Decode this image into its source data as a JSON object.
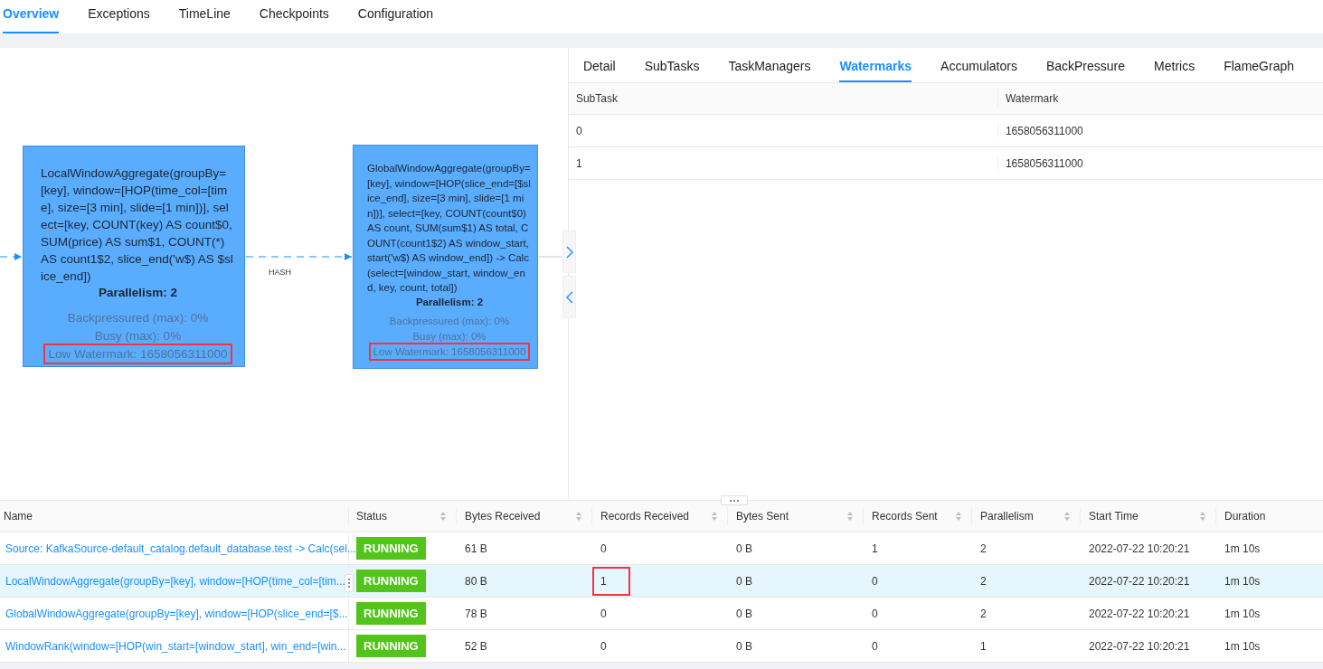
{
  "top_tabs": [
    {
      "label": "Overview",
      "selected": true
    },
    {
      "label": "Exceptions",
      "selected": false
    },
    {
      "label": "TimeLine",
      "selected": false
    },
    {
      "label": "Checkpoints",
      "selected": false
    },
    {
      "label": "Configuration",
      "selected": false
    }
  ],
  "graph": {
    "nodes": [
      {
        "text": "LocalWindowAggregate(groupBy=[key], window=[HOP(time_col=[time], size=[3 min], slide=[1 min])], select=[key, COUNT(key) AS count$0, SUM(price) AS sum$1, COUNT(*) AS count1$2, slice_end('w$) AS $slice_end])",
        "parallelism": "Parallelism: 2",
        "metrics": [
          {
            "text": "Backpressured (max): 0%",
            "highlighted": false
          },
          {
            "text": "Busy (max): 0%",
            "highlighted": false
          },
          {
            "text": "Low Watermark: 1658056311000",
            "highlighted": true
          }
        ]
      },
      {
        "text": "GlobalWindowAggregate(groupBy=[key], window=[HOP(slice_end=[$slice_end], size=[3 min], slide=[1 min])], select=[key, COUNT(count$0) AS count, SUM(sum$1) AS total, COUNT(count1$2) AS window_start, start('w$) AS window_end]) -> Calc(select=[window_start, window_end, key, count, total])",
        "parallelism": "Parallelism: 2",
        "metrics": [
          {
            "text": "Backpressured (max): 0%",
            "highlighted": false
          },
          {
            "text": "Busy (max): 0%",
            "highlighted": false
          },
          {
            "text": "Low Watermark: 1658056311000",
            "highlighted": true
          }
        ]
      }
    ],
    "edges": [
      {
        "kind": "incoming"
      },
      {
        "kind": "link",
        "label": "HASH"
      },
      {
        "kind": "outgoing"
      }
    ]
  },
  "detail_tabs": [
    {
      "label": "Detail",
      "selected": false
    },
    {
      "label": "SubTasks",
      "selected": false
    },
    {
      "label": "TaskManagers",
      "selected": false
    },
    {
      "label": "Watermarks",
      "selected": true
    },
    {
      "label": "Accumulators",
      "selected": false
    },
    {
      "label": "BackPressure",
      "selected": false
    },
    {
      "label": "Metrics",
      "selected": false
    },
    {
      "label": "FlameGraph",
      "selected": false
    }
  ],
  "watermarks": {
    "columns": [
      "SubTask",
      "Watermark"
    ],
    "rows": [
      [
        "0",
        "1658056311000"
      ],
      [
        "1",
        "1658056311000"
      ]
    ]
  },
  "vertex_table": {
    "columns": [
      {
        "label": "Name",
        "kind": "link",
        "sortable": false
      },
      {
        "label": "Status",
        "kind": "badge",
        "sortable": true
      },
      {
        "label": "Bytes Received",
        "kind": "text",
        "sortable": true
      },
      {
        "label": "Records Received",
        "kind": "text",
        "sortable": true
      },
      {
        "label": "Bytes Sent",
        "kind": "text",
        "sortable": true
      },
      {
        "label": "Records Sent",
        "kind": "text",
        "sortable": true
      },
      {
        "label": "Parallelism",
        "kind": "text",
        "sortable": true
      },
      {
        "label": "Start Time",
        "kind": "text",
        "sortable": true
      },
      {
        "label": "Duration",
        "kind": "text",
        "sortable": false
      }
    ],
    "rows": [
      {
        "selected": false,
        "cells": [
          {
            "text": "Source: KafkaSource-default_catalog.default_database.test -> Calc(sel...",
            "highlighted": false
          },
          {
            "text": "RUNNING",
            "highlighted": false
          },
          {
            "text": "61 B",
            "highlighted": false
          },
          {
            "text": "0",
            "highlighted": false
          },
          {
            "text": "0 B",
            "highlighted": false
          },
          {
            "text": "1",
            "highlighted": false
          },
          {
            "text": "2",
            "highlighted": false
          },
          {
            "text": "2022-07-22 10:20:21",
            "highlighted": false
          },
          {
            "text": "1m 10s",
            "highlighted": false
          }
        ]
      },
      {
        "selected": true,
        "cells": [
          {
            "text": "LocalWindowAggregate(groupBy=[key], window=[HOP(time_col=[tim...",
            "highlighted": false
          },
          {
            "text": "RUNNING",
            "highlighted": false
          },
          {
            "text": "80 B",
            "highlighted": false
          },
          {
            "text": "1",
            "highlighted": true
          },
          {
            "text": "0 B",
            "highlighted": false
          },
          {
            "text": "0",
            "highlighted": false
          },
          {
            "text": "2",
            "highlighted": false
          },
          {
            "text": "2022-07-22 10:20:21",
            "highlighted": false
          },
          {
            "text": "1m 10s",
            "highlighted": false
          }
        ]
      },
      {
        "selected": false,
        "cells": [
          {
            "text": "GlobalWindowAggregate(groupBy=[key], window=[HOP(slice_end=[$...",
            "highlighted": false
          },
          {
            "text": "RUNNING",
            "highlighted": false
          },
          {
            "text": "78 B",
            "highlighted": false
          },
          {
            "text": "0",
            "highlighted": false
          },
          {
            "text": "0 B",
            "highlighted": false
          },
          {
            "text": "0",
            "highlighted": false
          },
          {
            "text": "2",
            "highlighted": false
          },
          {
            "text": "2022-07-22 10:20:21",
            "highlighted": false
          },
          {
            "text": "1m 10s",
            "highlighted": false
          }
        ]
      },
      {
        "selected": false,
        "cells": [
          {
            "text": "WindowRank(window=[HOP(win_start=[window_start], win_end=[win...",
            "highlighted": false
          },
          {
            "text": "RUNNING",
            "highlighted": false
          },
          {
            "text": "52 B",
            "highlighted": false
          },
          {
            "text": "0",
            "highlighted": false
          },
          {
            "text": "0 B",
            "highlighted": false
          },
          {
            "text": "0",
            "highlighted": false
          },
          {
            "text": "1",
            "highlighted": false
          },
          {
            "text": "2022-07-22 10:20:21",
            "highlighted": false
          },
          {
            "text": "1m 10s",
            "highlighted": false
          }
        ]
      }
    ]
  }
}
